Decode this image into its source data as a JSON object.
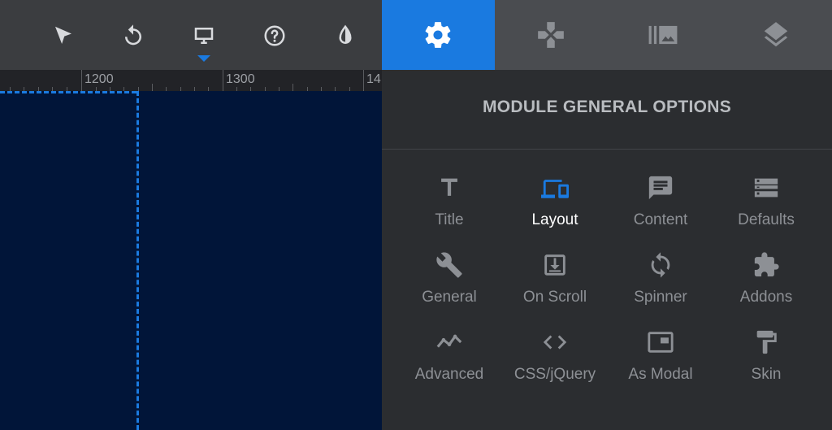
{
  "toolbar": {
    "buttons": [
      {
        "icon": "pointer-icon"
      },
      {
        "icon": "undo-icon"
      },
      {
        "icon": "monitor-icon",
        "active": true
      },
      {
        "icon": "help-icon"
      },
      {
        "icon": "contrast-icon"
      }
    ]
  },
  "ruler": {
    "labels": [
      "1200",
      "1300",
      "14"
    ]
  },
  "tabs": [
    {
      "icon": "gear-icon",
      "active": true
    },
    {
      "icon": "gamepad-icon"
    },
    {
      "icon": "media-library-icon"
    },
    {
      "icon": "layers-icon"
    }
  ],
  "panel": {
    "title": "MODULE GENERAL OPTIONS",
    "options": [
      {
        "label": "Title",
        "icon": "title-icon"
      },
      {
        "label": "Layout",
        "icon": "devices-icon",
        "active": true
      },
      {
        "label": "Content",
        "icon": "comment-icon"
      },
      {
        "label": "Defaults",
        "icon": "storage-icon"
      },
      {
        "label": "General",
        "icon": "wrench-icon"
      },
      {
        "label": "On Scroll",
        "icon": "scroll-icon"
      },
      {
        "label": "Spinner",
        "icon": "sync-icon"
      },
      {
        "label": "Addons",
        "icon": "puzzle-icon"
      },
      {
        "label": "Advanced",
        "icon": "chart-line-icon"
      },
      {
        "label": "CSS/jQuery",
        "icon": "code-icon"
      },
      {
        "label": "As Modal",
        "icon": "modal-icon"
      },
      {
        "label": "Skin",
        "icon": "paint-roller-icon"
      }
    ]
  },
  "colors": {
    "accent": "#1a7ae0",
    "canvas": "#011539",
    "toolbar": "#3b3d40",
    "panel": "#2b2d30"
  }
}
